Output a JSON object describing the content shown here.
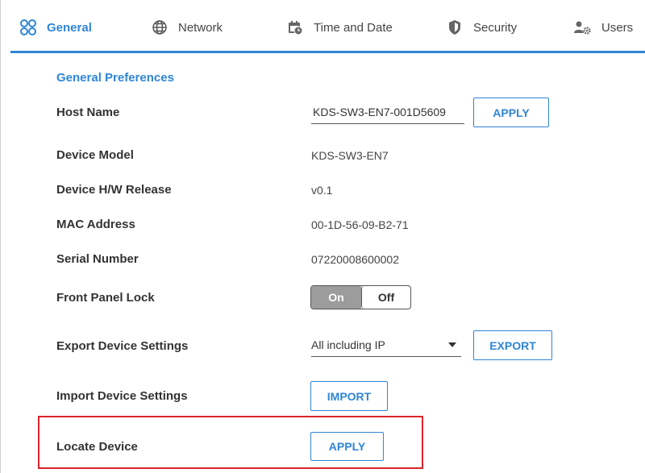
{
  "tabs": [
    {
      "label": "General",
      "icon": "general-grid-icon",
      "active": true
    },
    {
      "label": "Network",
      "icon": "globe-icon",
      "active": false
    },
    {
      "label": "Time and Date",
      "icon": "calendar-clock-icon",
      "active": false
    },
    {
      "label": "Security",
      "icon": "shield-icon",
      "active": false
    },
    {
      "label": "Users",
      "icon": "users-gear-icon",
      "active": false
    }
  ],
  "colors": {
    "accent": "#2f86d6",
    "highlight": "#d9242a",
    "toggle_on": "#9c9c9c"
  },
  "general": {
    "section_title": "General Preferences",
    "host_name": {
      "label": "Host Name",
      "value": "KDS-SW3-EN7-001D5609",
      "button": "APPLY"
    },
    "device_model": {
      "label": "Device Model",
      "value": "KDS-SW3-EN7"
    },
    "hw_release": {
      "label": "Device H/W Release",
      "value": "v0.1"
    },
    "mac_address": {
      "label": "MAC Address",
      "value": "00-1D-56-09-B2-71"
    },
    "serial_number": {
      "label": "Serial Number",
      "value": "07220008600002"
    },
    "front_panel_lock": {
      "label": "Front Panel Lock",
      "on": "On",
      "off": "Off",
      "state": "On"
    },
    "export_settings": {
      "label": "Export Device Settings",
      "selected": "All including IP",
      "button": "EXPORT"
    },
    "import_settings": {
      "label": "Import Device Settings",
      "button": "IMPORT"
    },
    "locate_device": {
      "label": "Locate Device",
      "button": "APPLY"
    }
  }
}
